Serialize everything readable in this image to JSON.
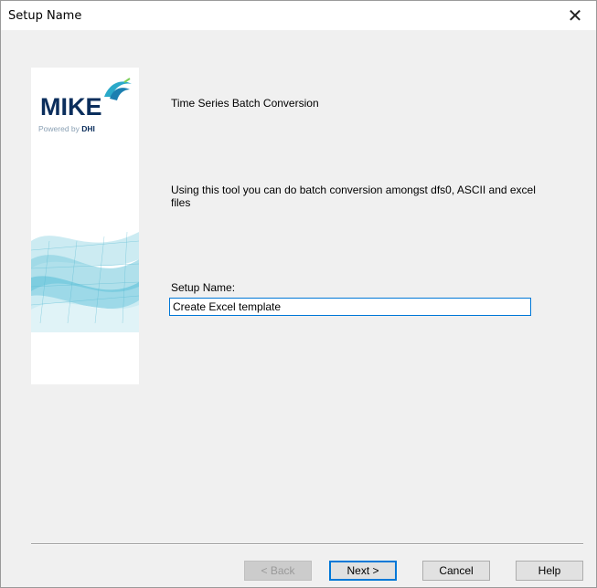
{
  "window": {
    "title": "Setup Name",
    "close_glyph": "✕"
  },
  "banner": {
    "logo": "MIKE",
    "powered_prefix": "Powered by",
    "powered_brand": "DHI"
  },
  "content": {
    "heading": "Time Series Batch Conversion",
    "description": "Using this tool you can do batch conversion amongst dfs0, ASCII and excel files",
    "setup_label": "Setup Name:",
    "setup_value": "Create Excel template"
  },
  "buttons": {
    "back": "< Back",
    "next": "Next >",
    "cancel": "Cancel",
    "help": "Help"
  },
  "colors": {
    "accent": "#0078d7",
    "logo": "#0b2e5c",
    "wave": "#2aa9c9"
  }
}
